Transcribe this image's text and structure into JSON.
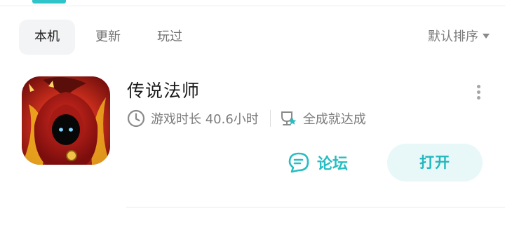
{
  "tabs": [
    {
      "label": "本机",
      "active": true
    },
    {
      "label": "更新",
      "active": false
    },
    {
      "label": "玩过",
      "active": false
    }
  ],
  "sort": {
    "label": "默认排序",
    "icon": "caret-down-icon"
  },
  "game": {
    "title": "传说法师",
    "icon_name": "game-icon-wizard",
    "playtime": "游戏时长 40.6小时",
    "playtime_icon": "clock-icon",
    "achievement": "全成就达成",
    "achievement_icon": "trophy-icon",
    "forum_label": "论坛",
    "forum_icon": "chat-bubble-icon",
    "open_label": "打开"
  },
  "colors": {
    "accent": "#2fc4c9",
    "open_bg": "#e8f7f8",
    "muted_text": "#7b7b7b"
  }
}
